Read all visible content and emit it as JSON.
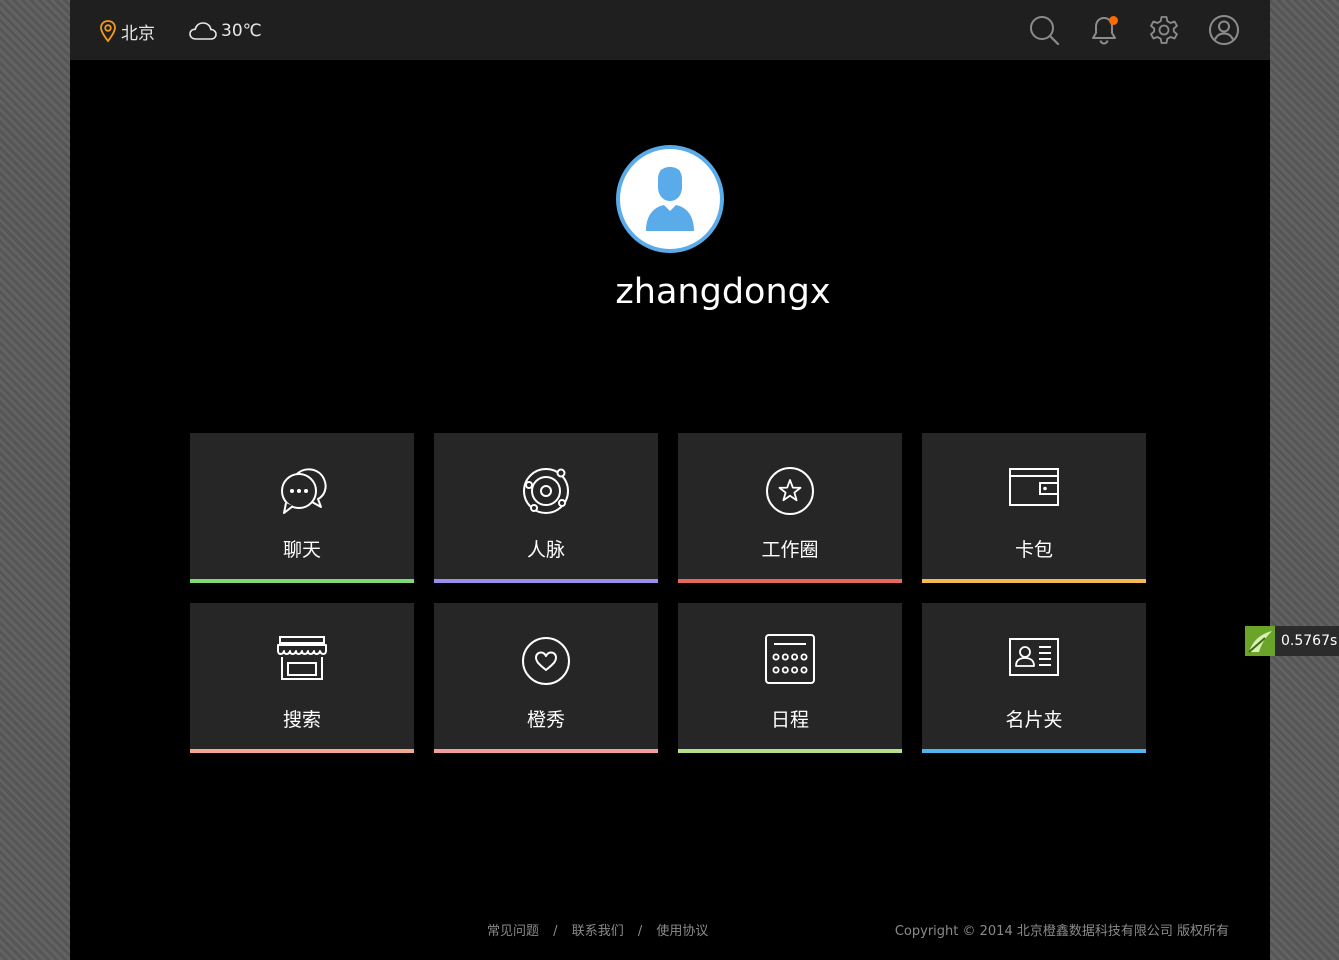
{
  "header": {
    "location": "北京",
    "temperature": "30℃",
    "icons": [
      "location-pin-icon",
      "cloud-icon",
      "search-icon",
      "bell-icon",
      "gear-icon",
      "user-icon"
    ],
    "notification_badge_color": "#ff6a00"
  },
  "profile": {
    "username": "zhangdongx",
    "avatar_ring_color": "#5aabea"
  },
  "tiles": [
    {
      "label": "聊天",
      "icon": "chat-bubbles-icon",
      "color": "#7cdb74"
    },
    {
      "label": "人脉",
      "icon": "network-orbit-icon",
      "color": "#9b8cf0"
    },
    {
      "label": "工作圈",
      "icon": "star-circle-icon",
      "color": "#e8665a"
    },
    {
      "label": "卡包",
      "icon": "wallet-icon",
      "color": "#f5b94f"
    },
    {
      "label": "搜索",
      "icon": "storefront-icon",
      "color": "#f2a88e"
    },
    {
      "label": "橙秀",
      "icon": "heart-circle-icon",
      "color": "#f29c9c"
    },
    {
      "label": "日程",
      "icon": "calendar-grid-icon",
      "color": "#b4e08c"
    },
    {
      "label": "名片夹",
      "icon": "contact-card-icon",
      "color": "#4fb4f0"
    }
  ],
  "footer": {
    "links": [
      "常见问题",
      "联系我们",
      "使用协议"
    ],
    "separator": "/",
    "copyright": "Copyright © 2014 北京橙鑫数据科技有限公司 版权所有"
  },
  "perf_badge": {
    "value": "0.5767s",
    "color": "#6aa52a"
  }
}
